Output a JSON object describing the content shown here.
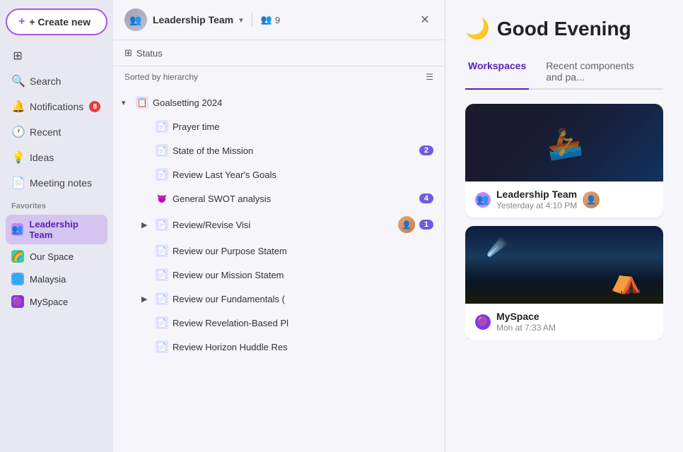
{
  "sidebar": {
    "createNew": "+ Create new",
    "items": [
      {
        "id": "sidebar-home",
        "icon": "⊞",
        "label": "Home"
      },
      {
        "id": "sidebar-search",
        "icon": "🔍",
        "label": "Search"
      },
      {
        "id": "sidebar-notifications",
        "icon": "🔔",
        "label": "Notifications",
        "badge": "8"
      },
      {
        "id": "sidebar-recent",
        "icon": "🕐",
        "label": "Recent"
      },
      {
        "id": "sidebar-ideas",
        "icon": "💡",
        "label": "Ideas"
      },
      {
        "id": "sidebar-meeting-notes",
        "icon": "📄",
        "label": "Meeting notes"
      }
    ],
    "favoritesLabel": "Favorites",
    "favorites": [
      {
        "id": "fav-leadership",
        "icon": "👥",
        "iconBg": "#c084fc",
        "label": "Leadership Team",
        "active": true
      },
      {
        "id": "fav-ourspace",
        "icon": "🌈",
        "iconBg": "#34d399",
        "label": "Our Space"
      },
      {
        "id": "fav-malaysia",
        "icon": "🌐",
        "iconBg": "#60a5fa",
        "label": "Malaysia"
      },
      {
        "id": "fav-myspace",
        "icon": "🟣",
        "iconBg": "#7c3aed",
        "label": "MySpace"
      }
    ]
  },
  "panel": {
    "title": "Leadership Team",
    "memberCount": "9",
    "statusLabel": "Status",
    "sortLabel": "Sorted by hierarchy",
    "items": [
      {
        "id": "goalsetting",
        "level": "parent",
        "expanded": true,
        "emoji": "📋",
        "label": "Goalsetting 2024",
        "hasMore": true
      },
      {
        "id": "prayer-time",
        "level": "child",
        "emoji": "📄",
        "label": "Prayer time"
      },
      {
        "id": "state-mission",
        "level": "child",
        "emoji": "📄",
        "label": "State of the Mission",
        "badge": "2"
      },
      {
        "id": "review-last-year",
        "level": "child",
        "emoji": "📄",
        "label": "Review Last Year's Goals"
      },
      {
        "id": "general-swot",
        "level": "child",
        "emoji": "😈",
        "label": "General SWOT analysis",
        "badge": "4"
      },
      {
        "id": "review-revise-visi",
        "level": "child",
        "emoji": "📄",
        "label": "Review/Revise Visi",
        "hasExpand": true,
        "avatar": true,
        "badge": "1"
      },
      {
        "id": "review-purpose",
        "level": "child",
        "emoji": "📄",
        "label": "Review our Purpose Statem"
      },
      {
        "id": "review-mission",
        "level": "child",
        "emoji": "📄",
        "label": "Review our Mission Statem"
      },
      {
        "id": "review-fundamentals",
        "level": "child",
        "emoji": "📄",
        "label": "Review our Fundamentals (",
        "hasExpand": true
      },
      {
        "id": "review-revelation",
        "level": "child",
        "emoji": "📄",
        "label": "Review Revelation-Based Pl"
      },
      {
        "id": "review-horizon",
        "level": "child",
        "emoji": "📄",
        "label": "Review Horizon Huddle Res"
      }
    ]
  },
  "main": {
    "greeting": "Good Evening",
    "moon": "🌙",
    "tabs": [
      {
        "id": "workspaces",
        "label": "Workspaces",
        "active": true
      },
      {
        "id": "recent",
        "label": "Recent components and pa..."
      }
    ],
    "cards": [
      {
        "id": "card-leadership",
        "type": "rowing",
        "icon": "👥",
        "iconBg": "#c084fc",
        "name": "Leadership Team",
        "time": "Yesterday at 4:10 PM",
        "hasAvatar": true
      },
      {
        "id": "card-myspace",
        "type": "night",
        "icon": "🟣",
        "iconBg": "#7c3aed",
        "name": "MySpace",
        "time": "Mon at 7:33 AM"
      }
    ]
  }
}
